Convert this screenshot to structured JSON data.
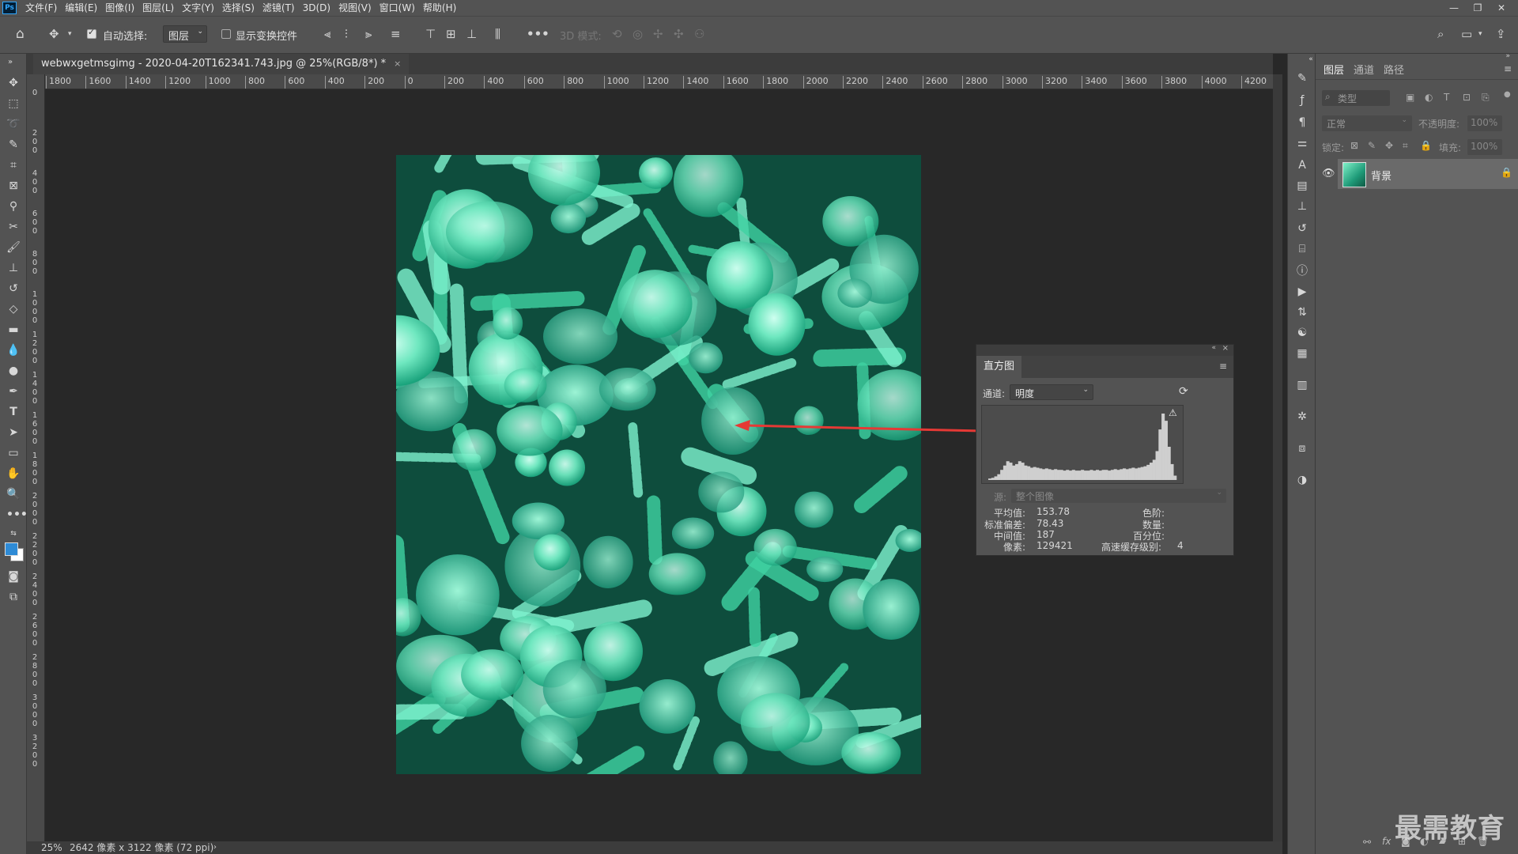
{
  "menubar": {
    "logo": "Ps",
    "items": [
      "文件(F)",
      "编辑(E)",
      "图像(I)",
      "图层(L)",
      "文字(Y)",
      "选择(S)",
      "滤镜(T)",
      "3D(D)",
      "视图(V)",
      "窗口(W)",
      "帮助(H)"
    ]
  },
  "options": {
    "auto_select_label": "自动选择:",
    "auto_select_value": "图层",
    "show_transform_label": "显示变换控件",
    "mode_3d_label": "3D 模式:"
  },
  "document": {
    "tab_title": "webwxgetmsgimg - 2020-04-20T162341.743.jpg @ 25%(RGB/8*) *"
  },
  "ruler": {
    "horizontal": [
      "1800",
      "1600",
      "1400",
      "1200",
      "1000",
      "800",
      "600",
      "400",
      "200",
      "0",
      "200",
      "400",
      "600",
      "800",
      "1000",
      "1200",
      "1400",
      "1600",
      "1800",
      "2000",
      "2200",
      "2400",
      "2600",
      "2800",
      "3000",
      "3200",
      "3400",
      "3600",
      "3800",
      "4000",
      "4200"
    ],
    "vertical": [
      "0",
      "2 0 0",
      "4 0 0",
      "6 0 0",
      "8 0 0",
      "1 0 0 0",
      "1 2 0 0",
      "1 4 0 0",
      "1 6 0 0",
      "1 8 0 0",
      "2 0 0 0",
      "2 2 0 0",
      "2 4 0 0",
      "2 6 0 0",
      "2 8 0 0",
      "3 0 0 0",
      "3 2 0 0"
    ]
  },
  "status": {
    "zoom": "25%",
    "info": "2642 像素 x 3122 像素 (72 ppi)"
  },
  "layers_panel": {
    "tabs": [
      "图层",
      "通道",
      "路径"
    ],
    "filter_placeholder": "类型",
    "blend_mode": "正常",
    "opacity_label": "不透明度:",
    "opacity_value": "100%",
    "lock_label": "锁定:",
    "fill_label": "填充:",
    "fill_value": "100%",
    "layer_name": "背景"
  },
  "histogram": {
    "tab": "直方图",
    "channel_label": "通道:",
    "channel_value": "明度",
    "source_label": "源:",
    "source_value": "整个图像",
    "stats": {
      "mean_label": "平均值:",
      "mean": "153.78",
      "std_label": "标准偏差:",
      "std": "78.43",
      "median_label": "中间值:",
      "median": "187",
      "pixels_label": "像素:",
      "pixels": "129421",
      "level_label": "色阶:",
      "count_label": "数量:",
      "percentile_label": "百分位:",
      "cache_label": "高速缓存级别:",
      "cache": "4"
    },
    "levels": [
      2,
      3,
      5,
      8,
      14,
      20,
      26,
      24,
      20,
      22,
      26,
      24,
      20,
      19,
      17,
      18,
      17,
      16,
      15,
      16,
      15,
      14,
      15,
      14,
      14,
      13,
      14,
      13,
      14,
      13,
      13,
      14,
      13,
      13,
      14,
      13,
      14,
      13,
      14,
      14,
      13,
      14,
      15,
      14,
      15,
      16,
      15,
      16,
      17,
      16,
      17,
      18,
      19,
      21,
      24,
      28,
      40,
      70,
      92,
      82,
      46,
      22,
      6
    ]
  },
  "watermark": "最需教育",
  "colors": {
    "accent_arrow": "#e53935",
    "foreground_swatch": "#2e8bd6",
    "background_swatch": "#ffffff"
  }
}
